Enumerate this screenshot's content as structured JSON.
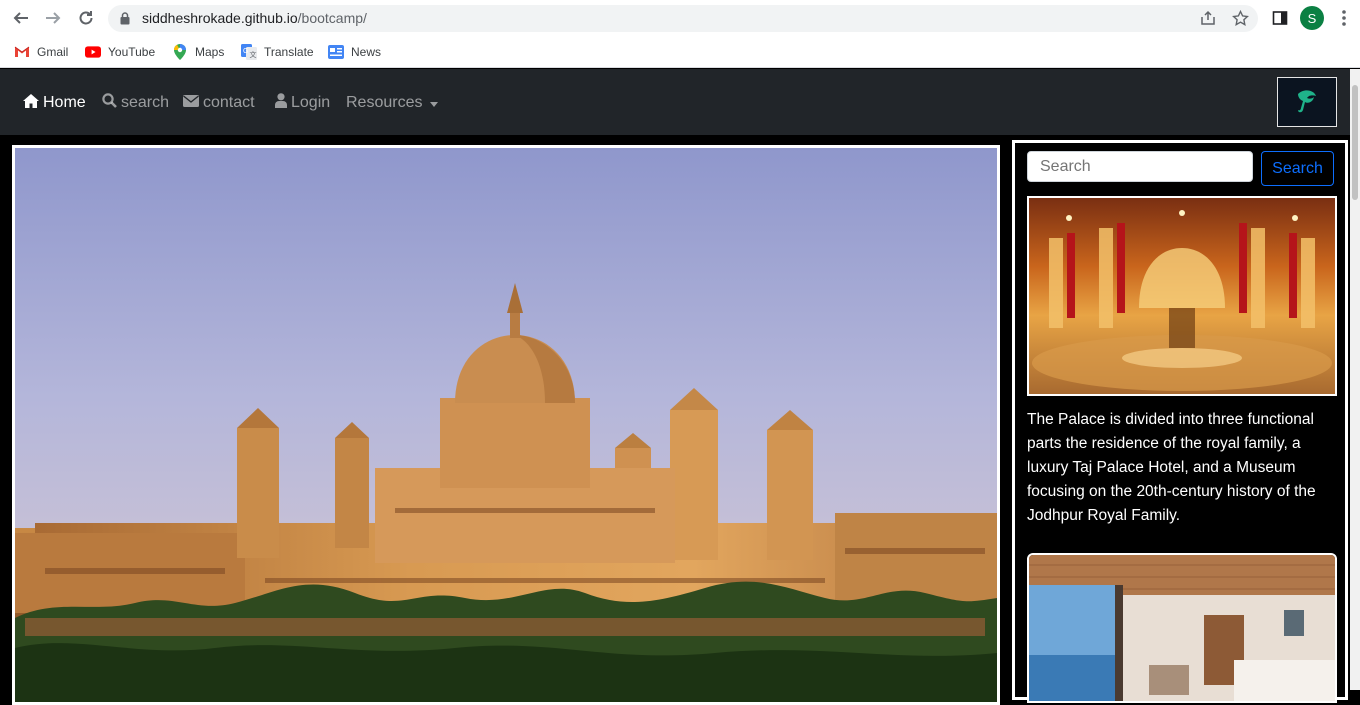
{
  "browser": {
    "url_host": "siddheshrokade.github.io",
    "url_path": "/bootcamp/",
    "profile_initial": "S",
    "bookmarks": [
      {
        "label": "Gmail",
        "icon": "gmail-icon"
      },
      {
        "label": "YouTube",
        "icon": "youtube-icon"
      },
      {
        "label": "Maps",
        "icon": "maps-icon"
      },
      {
        "label": "Translate",
        "icon": "translate-icon"
      },
      {
        "label": "News",
        "icon": "news-icon"
      }
    ]
  },
  "navbar": {
    "items": [
      {
        "label": "Home",
        "icon": "home-icon",
        "active": true
      },
      {
        "label": "search",
        "icon": "search-icon"
      },
      {
        "label": "contact",
        "icon": "envelope-icon"
      },
      {
        "label": "Login",
        "icon": "user-icon"
      },
      {
        "label": "Resources",
        "icon": "caret-down-icon",
        "dropdown": true
      }
    ]
  },
  "sidebar": {
    "search_placeholder": "Search",
    "search_button": "Search",
    "description": "The Palace is divided into three functional parts the residence of the royal family, a luxury Taj Palace Hotel, and a Museum focusing on the 20th-century history of the Jodhpur Royal Family."
  },
  "colors": {
    "navbar_bg": "#212529",
    "page_bg": "#000000",
    "primary": "#0d6efd",
    "palace_sandstone": "#d9a055"
  }
}
